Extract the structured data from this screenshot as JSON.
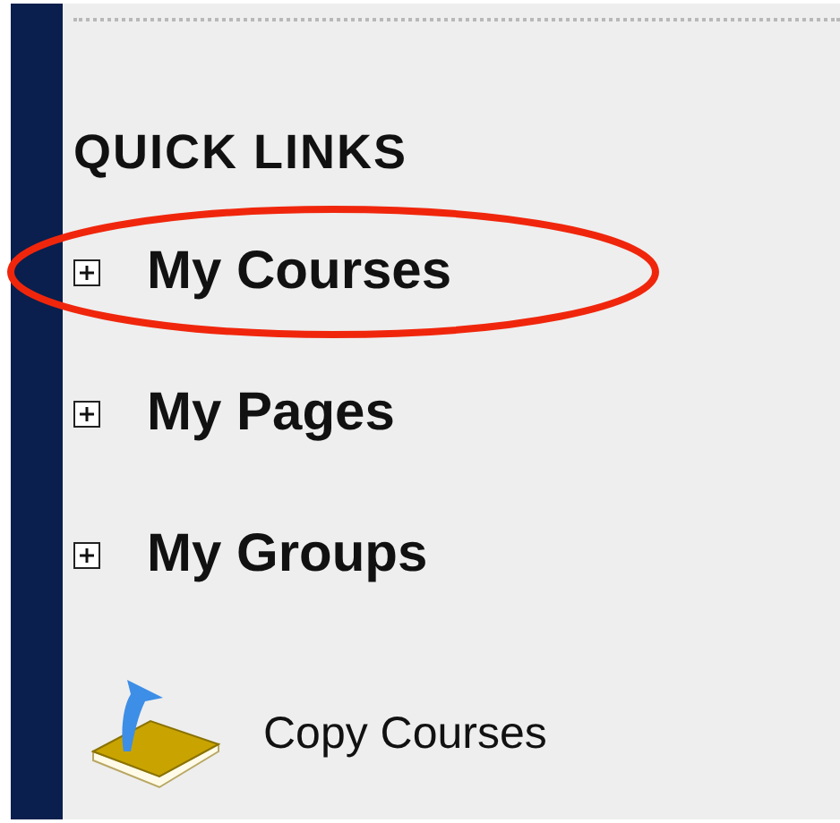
{
  "section": {
    "title": "QUICK LINKS"
  },
  "links": [
    {
      "label": "My Courses",
      "expanded": false,
      "circled": true
    },
    {
      "label": "My Pages",
      "expanded": false,
      "circled": false
    },
    {
      "label": "My Groups",
      "expanded": false,
      "circled": false
    }
  ],
  "tool": {
    "label": "Copy Courses"
  }
}
